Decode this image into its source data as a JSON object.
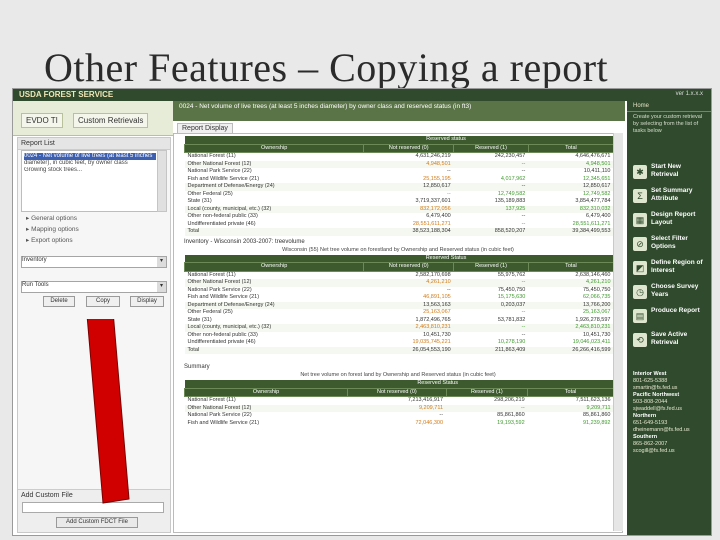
{
  "slide": {
    "title": "Other Features – Copying a report"
  },
  "banner": {
    "logo": "USDA FOREST SERVICE",
    "version": "ver 1.x.x.x"
  },
  "tabs": [
    "EVDO TI",
    "Custom Retrievals"
  ],
  "left": {
    "report_list_label": "Report List",
    "list_items": [
      "0024 - Net volume of live trees (at least 5 inches",
      "diameter), in cubic feet, by owner class",
      "Growing stock trees..."
    ],
    "options": [
      "General options",
      "Mapping options",
      "Export options"
    ],
    "select1": "Inventory",
    "select2": "Run Tools",
    "buttons": [
      "Delete",
      "Copy",
      "Display"
    ],
    "custom_file_label": "Add Custom File",
    "custom_button": "Add Custom FDCT File"
  },
  "report": {
    "header_text": "0024 - Net volume of live trees (at least 5 inches diameter) by owner class and reserved status (in ft3)",
    "tab_label": "Report Display",
    "table1": {
      "title": "",
      "group_label": "Reserved status",
      "columns": [
        "Ownership",
        "Not reserved (0)",
        "Reserved (1)",
        "Total"
      ],
      "rows": [
        [
          "National Forest (11)",
          "4,631,246,219",
          "242,230,457",
          "4,646,476,671"
        ],
        [
          "Other National Forest (12)",
          "4,948,501",
          "--",
          "4,948,501"
        ],
        [
          "National Park Service (22)",
          "--",
          "--",
          "10,411,110"
        ],
        [
          "Fish and Wildlife Service (21)",
          "25,155,195",
          "4,017,962",
          "12,345,651"
        ],
        [
          "Department of Defense/Energy (24)",
          "12,850,617",
          "--",
          "12,850,617"
        ],
        [
          "Other Federal (25)",
          "--",
          "12,749,582",
          "12,749,582"
        ],
        [
          "State (31)",
          "3,719,337,601",
          "135,189,883",
          "3,854,477,784"
        ],
        [
          "Local (county, municipal, etc.) (32)",
          "832,172,056",
          "137,925",
          "832,310,032"
        ],
        [
          "Other non-federal public (33)",
          "6,479,400",
          "--",
          "6,479,400"
        ],
        [
          "Undifferentiated private (46)",
          "28,551,611,271",
          "--",
          "28,551,611,271"
        ],
        [
          "Total",
          "38,523,188,304",
          "858,520,207",
          "39,384,499,553"
        ]
      ]
    },
    "table2_heading": "Inventory - Wisconsin 2003-2007: treevolume",
    "table2": {
      "title": "Wisconsin (55)   Net tree volume on forestland by Ownership and Reserved status (in cubic feet)",
      "group_label": "Reserved Status",
      "columns": [
        "Ownership",
        "Not reserved (0)",
        "Reserved (1)",
        "Total"
      ],
      "rows": [
        [
          "National Forest (11)",
          "2,582,170,698",
          "55,975,762",
          "2,638,146,460"
        ],
        [
          "Other National Forest (12)",
          "4,261,210",
          "--",
          "4,261,210"
        ],
        [
          "National Park Service (22)",
          "--",
          "75,450,750",
          "75,450,750"
        ],
        [
          "Fish and Wildlife Service (21)",
          "46,891,105",
          "15,175,630",
          "62,066,735"
        ],
        [
          "Department of Defense/Energy (24)",
          "13,563,163",
          "0,203,037",
          "13,766,200"
        ],
        [
          "Other Federal (25)",
          "25,163,067",
          "--",
          "25,163,067"
        ],
        [
          "State (31)",
          "1,872,496,765",
          "53,781,832",
          "1,926,278,597"
        ],
        [
          "Local (county, municipal, etc.) (32)",
          "2,463,810,231",
          "--",
          "2,463,810,231"
        ],
        [
          "Other non-federal public (33)",
          "10,451,730",
          "--",
          "10,451,730"
        ],
        [
          "Undifferentiated private (46)",
          "19,035,745,221",
          "10,278,190",
          "19,046,023,411"
        ],
        [
          "Total",
          "26,054,553,190",
          "211,863,409",
          "26,266,416,599"
        ]
      ]
    },
    "summary_heading": "Summary",
    "table3": {
      "title": "Net tree volume on forest land by Ownership and Reserved status (in cubic feet)",
      "group_label": "Reserved Status",
      "columns": [
        "Ownership",
        "Not reserved (0)",
        "Reserved (1)",
        "Total"
      ],
      "rows": [
        [
          "National Forest (11)",
          "7,213,416,917",
          "298,206,219",
          "7,511,623,136"
        ],
        [
          "Other National Forest (12)",
          "9,209,711",
          "--",
          "9,209,711"
        ],
        [
          "National Park Service (22)",
          "--",
          "85,861,860",
          "85,861,860"
        ],
        [
          "Fish and Wildlife Service (21)",
          "72,046,300",
          "19,193,592",
          "91,239,892"
        ]
      ]
    }
  },
  "right": {
    "home": "Home",
    "description": "Create your custom retrieval by selecting from the list of tasks below",
    "items": [
      {
        "icon": "✱",
        "label": "Start New Retrieval"
      },
      {
        "icon": "Σ",
        "label": "Set Summary Attribute"
      },
      {
        "icon": "▦",
        "label": "Design Report Layout"
      },
      {
        "icon": "⊘",
        "label": "Select Filter Options"
      },
      {
        "icon": "◩",
        "label": "Define Region of Interest"
      },
      {
        "icon": "◷",
        "label": "Choose Survey Years"
      },
      {
        "icon": "▤",
        "label": "Produce Report"
      },
      {
        "icon": "⟲",
        "label": "Save Active Retrieval"
      }
    ],
    "contact": [
      {
        "h": "Interior West",
        "t": "801-625-5388\nsmartin@fs.fed.us"
      },
      {
        "h": "Pacific Northwest",
        "t": "503-808-2044\nsjwaddell@fs.fed.us"
      },
      {
        "h": "Northern",
        "t": "651-649-5193\ndheinemann@fs.fed.us"
      },
      {
        "h": "Southern",
        "t": "865-862-2007\nscogill@fs.fed.us"
      }
    ]
  },
  "colors": {
    "banner": "#2f4a2c",
    "header": "#3c5a2e",
    "highlight": "#d10000"
  }
}
